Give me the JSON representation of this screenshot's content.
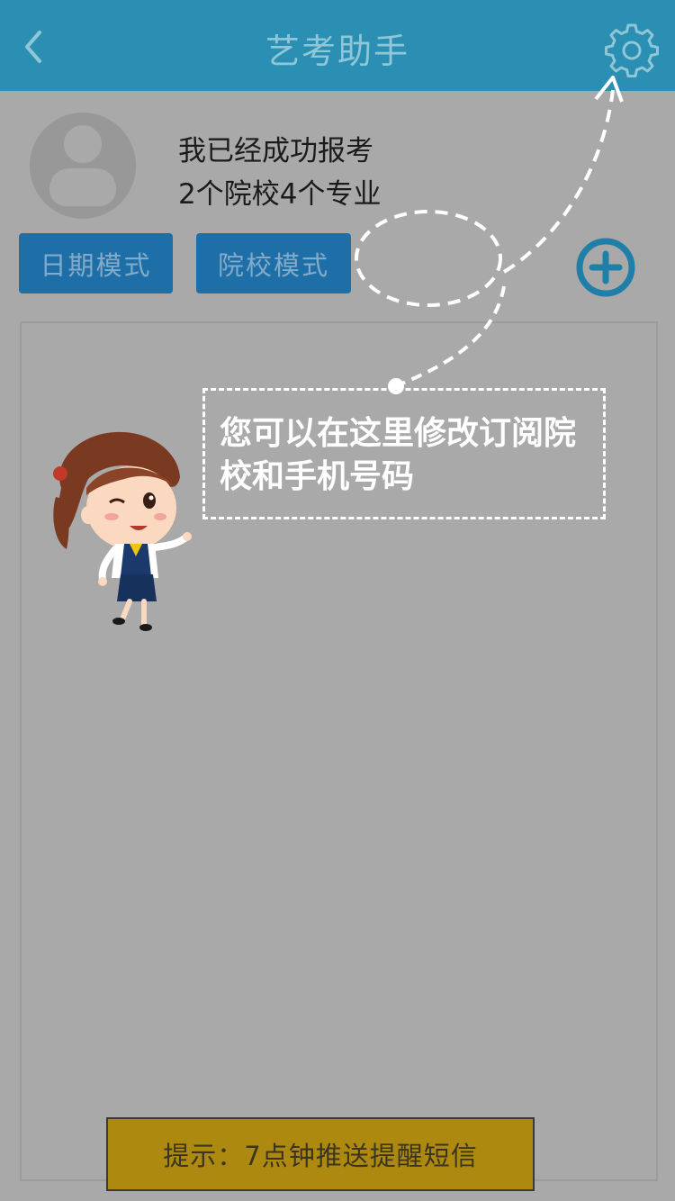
{
  "header": {
    "title": "艺考助手",
    "back_icon": "chevron-left-icon",
    "settings_icon": "gear-icon"
  },
  "profile": {
    "avatar_icon": "user-avatar-icon",
    "line1": "我已经成功报考",
    "line2": "2个院校4个专业"
  },
  "modes": {
    "date_label": "日期模式",
    "school_label": "院校模式"
  },
  "add_icon": "plus-circle-icon",
  "guide": {
    "text": "您可以在这里修改订阅院校和手机号码"
  },
  "hint": {
    "text": "提示：7点钟推送提醒短信"
  },
  "colors": {
    "header_bg": "#2a8fb2",
    "mode_button_bg": "#1e6fa8",
    "hint_bg": "#ad8910",
    "overlay_bg": "#a9a9a9"
  }
}
